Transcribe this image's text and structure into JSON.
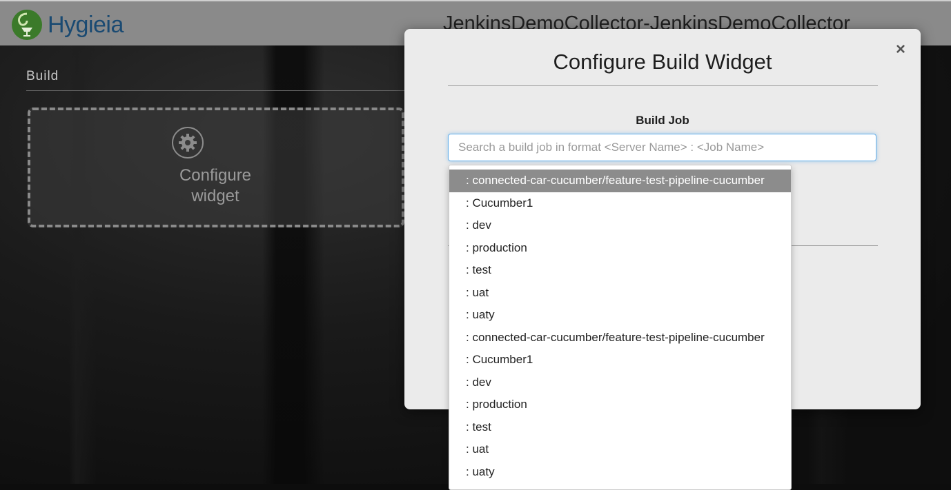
{
  "header": {
    "logo_text": "Hygieia",
    "dashboard_title": "JenkinsDemoCollector-JenkinsDemoCollector"
  },
  "build_widget": {
    "label": "Build",
    "configure_line1": "Configure",
    "configure_line2": "widget"
  },
  "modal": {
    "title": "Configure Build Widget",
    "close_glyph": "×",
    "field_label": "Build Job",
    "search_placeholder": "Search a build job in format <Server Name> : <Job Name>",
    "search_value": ""
  },
  "dropdown": {
    "items": [
      ": connected-car-cucumber/feature-test-pipeline-cucumber",
      ": Cucumber1",
      ": dev",
      ": production",
      ": test",
      ": uat",
      ": uaty",
      ": connected-car-cucumber/feature-test-pipeline-cucumber",
      ": Cucumber1",
      ": dev",
      ": production",
      ": test",
      ": uat",
      ": uaty"
    ],
    "active_index": 0
  },
  "colors": {
    "header_bg": "#8a8a8a",
    "logo_blue": "#1a4a72",
    "logo_green": "#3b7a2a",
    "modal_bg": "#ebebeb",
    "input_focus": "#66afe9",
    "active_item_bg": "#8c8c8c"
  }
}
